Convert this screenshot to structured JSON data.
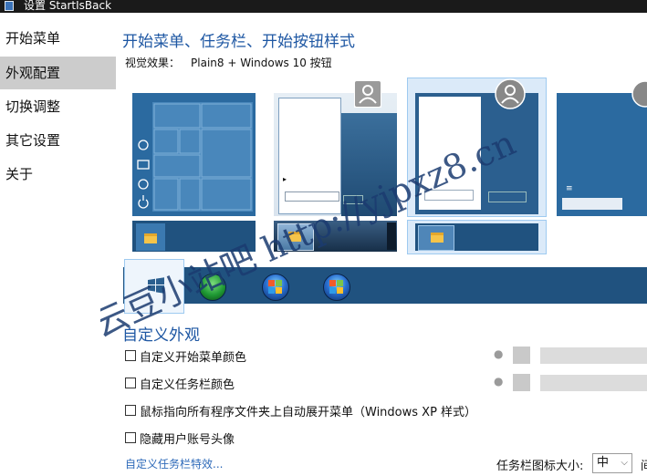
{
  "window": {
    "title": "设置 StartIsBack"
  },
  "sidebar": {
    "items": [
      {
        "label": "开始菜单",
        "active": false
      },
      {
        "label": "外观配置",
        "active": true
      },
      {
        "label": "切换调整",
        "active": false
      },
      {
        "label": "其它设置",
        "active": false
      },
      {
        "label": "关于",
        "active": false
      }
    ]
  },
  "main": {
    "section_title": "开始菜单、任务栏、开始按钮样式",
    "preview_label": "视觉效果：",
    "preview_value": "Plain8 + Windows 10 按钮",
    "customize_title": "自定义外观",
    "checkboxes": [
      {
        "label": "自定义开始菜单颜色",
        "checked": false
      },
      {
        "label": "自定义任务栏颜色",
        "checked": false
      },
      {
        "label": "鼠标指向所有程序文件夹上自动展开菜单（Windows XP 样式）",
        "checked": false
      },
      {
        "label": "隐藏用户账号头像",
        "checked": false
      }
    ],
    "link": "自定义任务栏特效...",
    "icon_size_label": "任务栏图标大小:",
    "icon_size_value": "中",
    "trailing_cut_text": "间"
  },
  "colors": {
    "accent": "#1e57a3",
    "start_blue": "#2b6aa0",
    "taskbar": "#20527f",
    "selected_border": "#9ecaf0"
  },
  "watermark": "云豆小站吧 http://yjpxz8.cn"
}
